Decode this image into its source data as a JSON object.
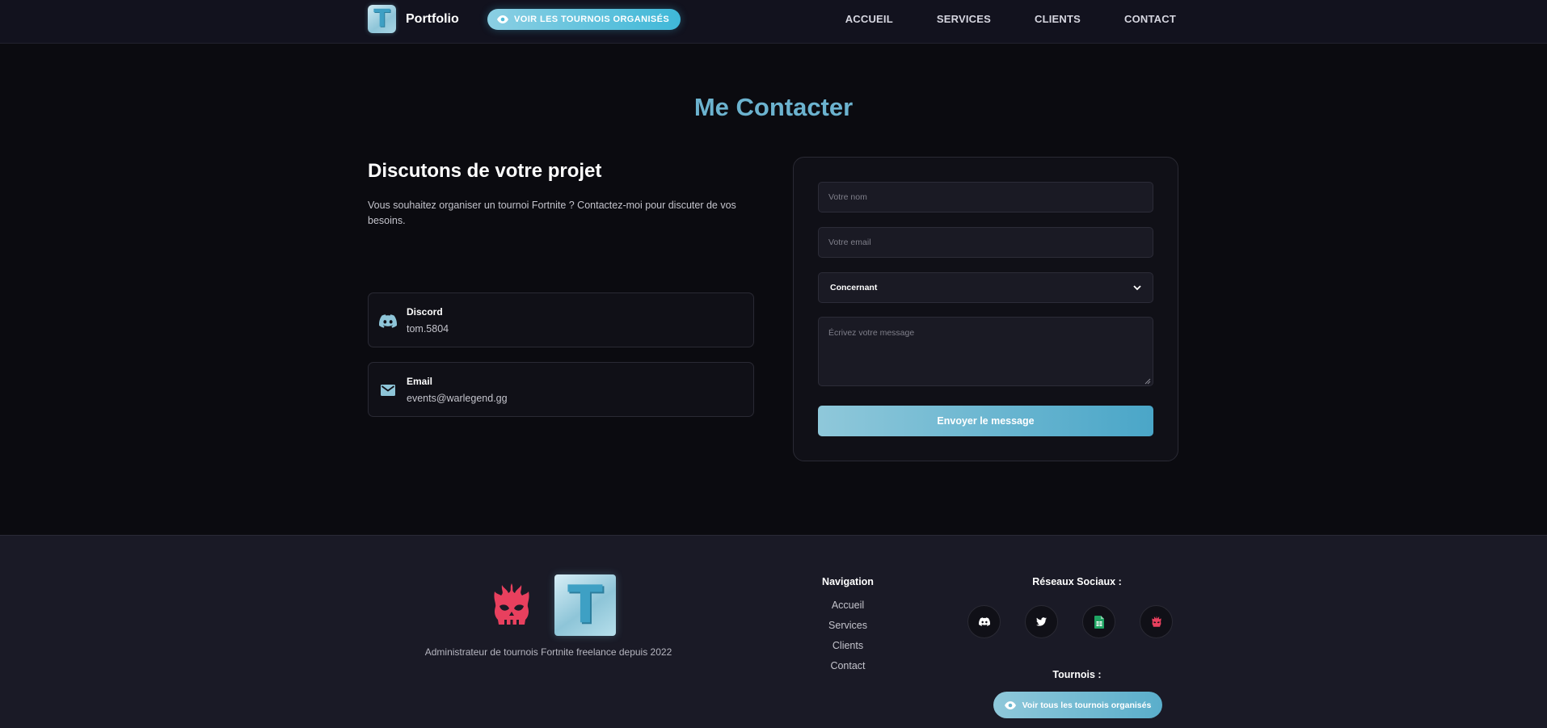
{
  "colors": {
    "accent": "#6cb3cf",
    "nav_bg": "#12121e",
    "page_bg": "#0b0b10",
    "footer_bg": "#1a1a26",
    "skull_red": "#e8405e",
    "sheets_green": "#1fa463"
  },
  "navbar": {
    "logo_letter": "T",
    "brand": "Portfolio",
    "tournaments_button": {
      "icon": "eye-icon",
      "label": "VOIR LES TOURNOIS ORGANISÉS"
    },
    "links": [
      "ACCUEIL",
      "SERVICES",
      "CLIENTS",
      "CONTACT"
    ]
  },
  "contact": {
    "title": "Me Contacter",
    "heading": "Discutons de votre projet",
    "intro": "Vous souhaitez organiser un tournoi Fortnite ? Contactez-moi pour discuter de vos besoins.",
    "cards": [
      {
        "icon": "discord-icon",
        "title": "Discord",
        "value": "tom.5804"
      },
      {
        "icon": "mail-icon",
        "title": "Email",
        "value": "events@warlegend.gg"
      }
    ],
    "form": {
      "name_placeholder": "Votre nom",
      "email_placeholder": "Votre email",
      "subject_selected": "Concernant",
      "message_placeholder": "Écrivez votre message",
      "submit_label": "Envoyer le message"
    }
  },
  "footer": {
    "logo_letter": "T",
    "tagline": "Administrateur de tournois Fortnite freelance depuis 2022",
    "navigation": {
      "heading": "Navigation",
      "links": [
        "Accueil",
        "Services",
        "Clients",
        "Contact"
      ]
    },
    "social": {
      "heading": "Réseaux Sociaux :",
      "icons": [
        "discord-icon",
        "twitter-icon",
        "google-sheets-icon",
        "warlegend-skull-icon"
      ]
    },
    "tournaments": {
      "heading": "Tournois :",
      "button_label": "Voir tous les tournois organisés",
      "button_icon": "eye-icon"
    }
  }
}
